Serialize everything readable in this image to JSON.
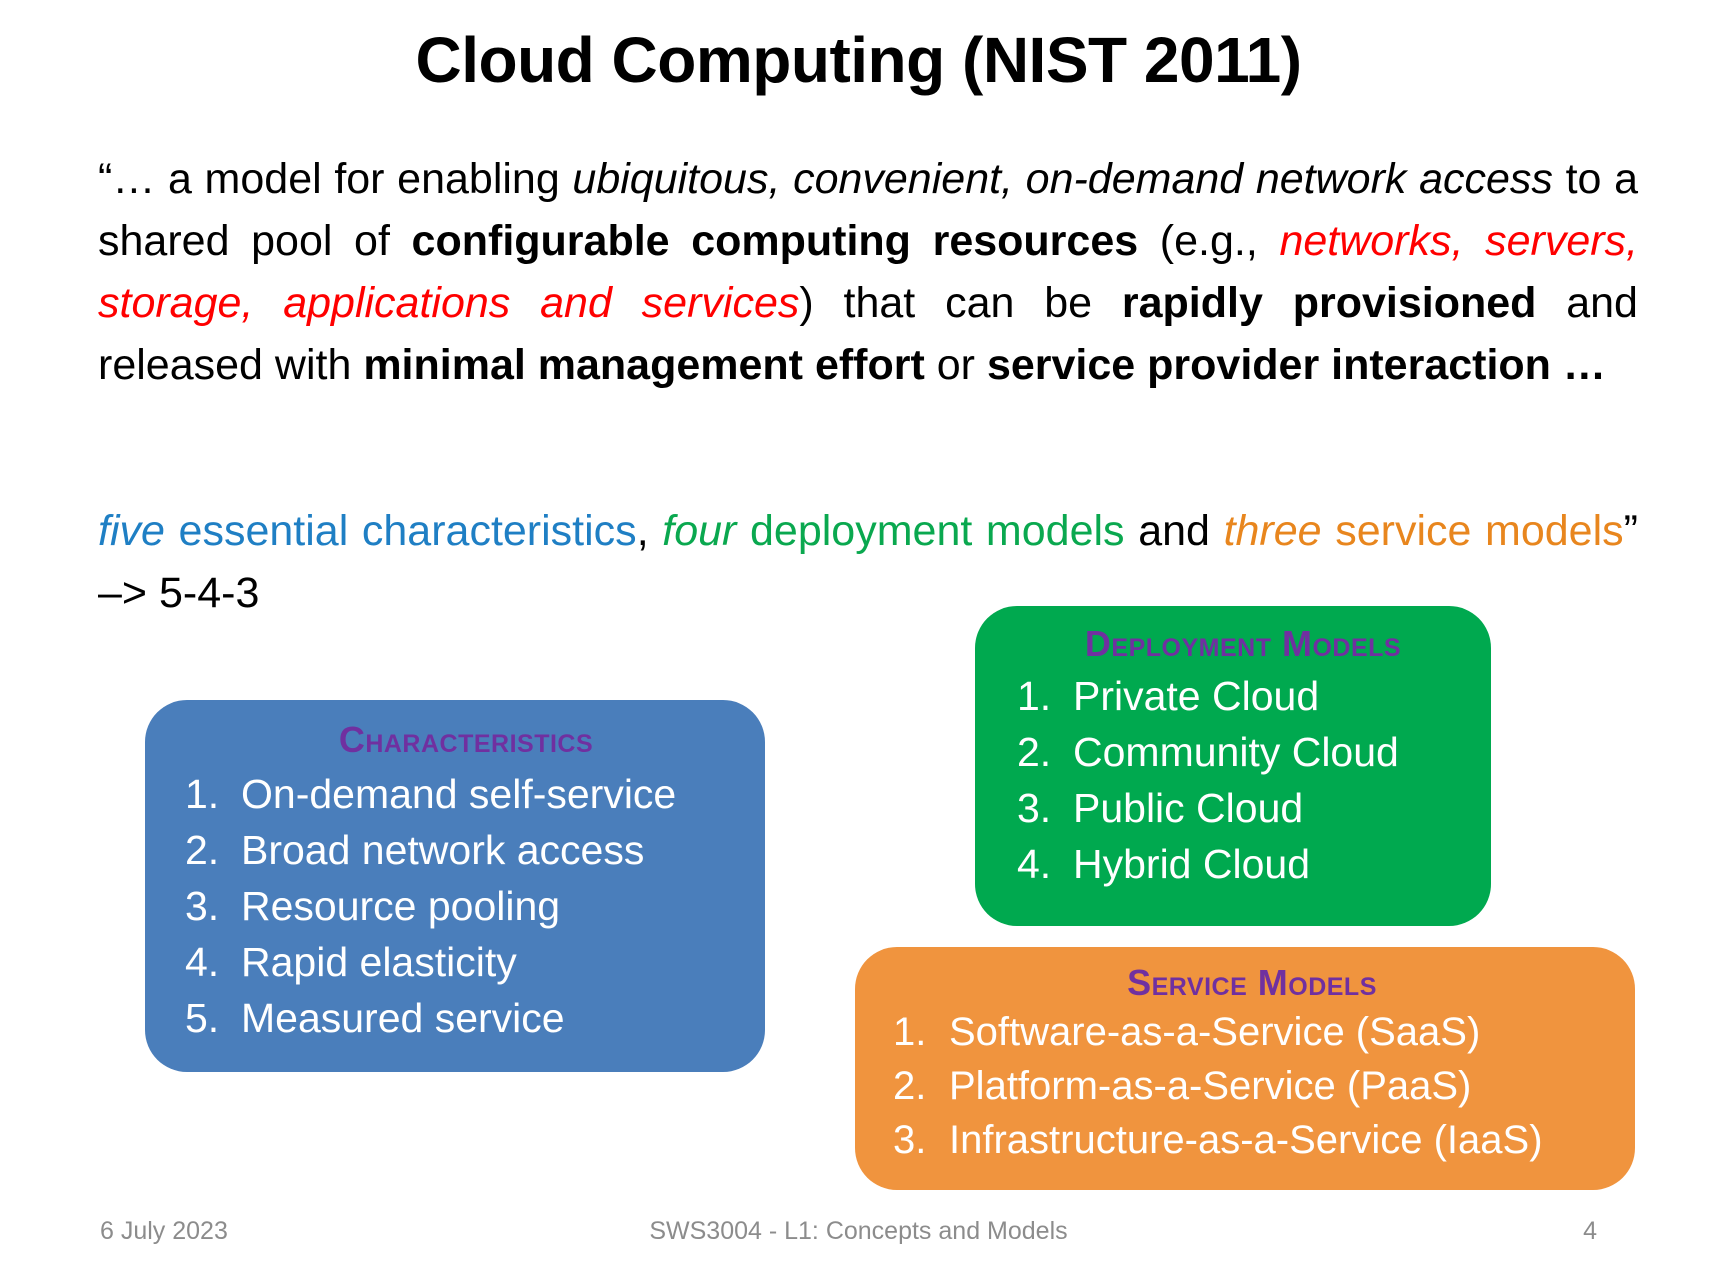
{
  "slide": {
    "title": "Cloud Computing (NIST 2011)",
    "quote": {
      "segments": [
        {
          "text": "“… a model for enabling ",
          "style": "plain"
        },
        {
          "text": "ubiquitous, convenient, on-demand network access",
          "style": "italic"
        },
        {
          "text": " to a shared pool of ",
          "style": "plain"
        },
        {
          "text": "configurable computing resources",
          "style": "bold"
        },
        {
          "text": " (e.g., ",
          "style": "plain"
        },
        {
          "text": "networks, servers, storage, applications and services",
          "style": "italic-red"
        },
        {
          "text": ") that can be ",
          "style": "plain"
        },
        {
          "text": "rapidly provisioned",
          "style": "bold"
        },
        {
          "text": " and released with ",
          "style": "plain"
        },
        {
          "text": "minimal management effort",
          "style": "bold"
        },
        {
          "text": " or ",
          "style": "plain"
        },
        {
          "text": "service provider interaction …",
          "style": "bold"
        }
      ]
    },
    "counts": {
      "segments": [
        {
          "text": "five",
          "style": "italic-blue"
        },
        {
          "text": " essential characteristics",
          "style": "blue"
        },
        {
          "text": ", ",
          "style": "black"
        },
        {
          "text": "four",
          "style": "italic-green"
        },
        {
          "text": " deployment models",
          "style": "green"
        },
        {
          "text": " and ",
          "style": "black"
        },
        {
          "text": "three",
          "style": "italic-orange"
        },
        {
          "text": " service models",
          "style": "orange"
        },
        {
          "text": "” –> 5-4-3",
          "style": "black"
        }
      ]
    },
    "boxes": {
      "characteristics": {
        "heading": "Characteristics",
        "color": "#4A7EBB",
        "items": [
          {
            "num": "1.",
            "label": "On-demand self-service"
          },
          {
            "num": "2.",
            "label": "Broad network access"
          },
          {
            "num": "3.",
            "label": "Resource pooling"
          },
          {
            "num": "4.",
            "label": "Rapid elasticity"
          },
          {
            "num": "5.",
            "label": "Measured service"
          }
        ]
      },
      "deployment": {
        "heading": "Deployment Models",
        "color": "#00A94F",
        "items": [
          {
            "num": "1.",
            "label": "Private Cloud"
          },
          {
            "num": "2.",
            "label": "Community Cloud"
          },
          {
            "num": "3.",
            "label": "Public Cloud"
          },
          {
            "num": "4.",
            "label": "Hybrid Cloud"
          }
        ]
      },
      "service": {
        "heading": "Service Models",
        "color": "#F0943E",
        "items": [
          {
            "num": "1.",
            "label": "Software-as-a-Service (SaaS)"
          },
          {
            "num": "2.",
            "label": "Platform-as-a-Service (PaaS)"
          },
          {
            "num": "3.",
            "label": "Infrastructure-as-a-Service (IaaS)"
          }
        ]
      }
    },
    "footer": {
      "date": "6 July 2023",
      "center": "SWS3004 - L1: Concepts and Models",
      "page": "4"
    },
    "colors": {
      "heading_purple": "#7030A0",
      "red": "#FF0000",
      "blue": "#1F7FC4",
      "green": "#0AA84F",
      "orange": "#E8861E",
      "footer_gray": "#8C8C8C"
    }
  }
}
